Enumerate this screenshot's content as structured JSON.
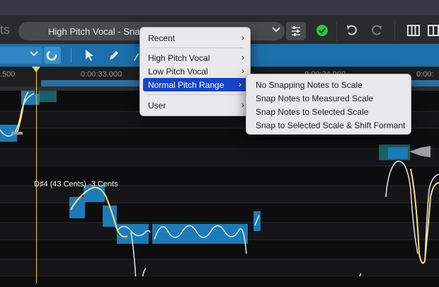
{
  "toolbar": {
    "app_title_fragment": "ts",
    "preset_label": "High Pitch Vocal - Snap",
    "icons": [
      "chevron-down-icon",
      "sliders-icon",
      "status-check-icon",
      "undo-icon",
      "redo-icon",
      "columns-icon",
      "more-icon"
    ],
    "status_color": "#28c840"
  },
  "toolrow": {
    "accent": "#1b6fab",
    "tools": [
      "snap-magnet-icon",
      "select-arrow-icon",
      "pencil-icon"
    ]
  },
  "ruler": {
    "labels": [
      ".500",
      "0:00:33.000",
      "0:00:34.000",
      "0:00:"
    ]
  },
  "note_tooltip": "D♯4 (43 Cents) -3 Cents",
  "main_menu": {
    "items": [
      {
        "label": "Recent",
        "submenu": true
      },
      {
        "label": "High Pitch Vocal",
        "submenu": true
      },
      {
        "label": "Low Pitch Vocal",
        "submenu": true
      },
      {
        "label": "Normal Pitch Range",
        "submenu": true,
        "selected": true
      },
      {
        "label": "User",
        "submenu": true
      }
    ],
    "arrow": "›"
  },
  "sub_menu": {
    "items": [
      "No Snapping Notes to Scale",
      "Snap Notes to Measured Scale",
      "Snap Notes to Selected Scale",
      "Snap to Selected Scale & Shift Formant"
    ]
  },
  "colors": {
    "note_blob": "#1e8fd6",
    "pitch_curve": "#f5e27a",
    "playhead": "#f0d24a",
    "menu_highlight": "#1745c9"
  }
}
